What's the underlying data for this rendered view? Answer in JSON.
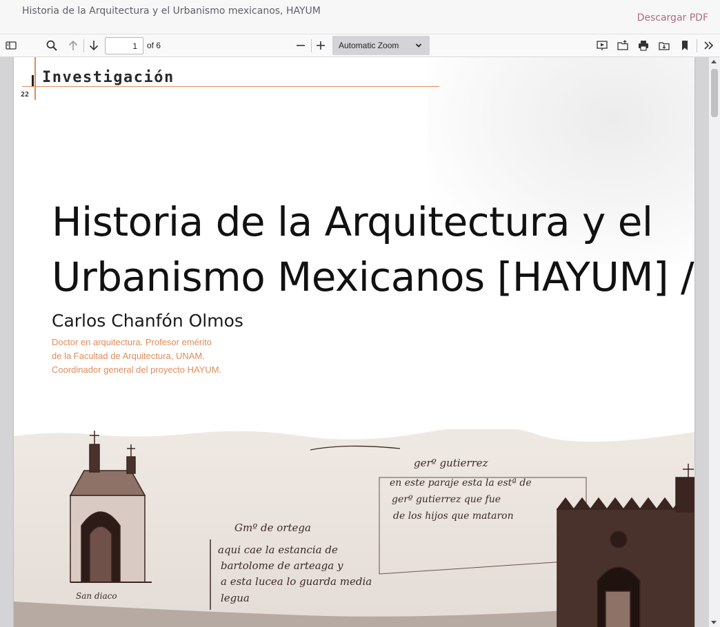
{
  "header": {
    "title": "Historia de la Arquitectura y el Urbanismo mexicanos, HAYUM",
    "download_label": "Descargar PDF"
  },
  "toolbar": {
    "current_page": "1",
    "page_count": "of 6",
    "zoom": "Automatic Zoom"
  },
  "page": {
    "section": "Investigación",
    "page_number": "22",
    "title_line1": "Historia de la Arquitectura y el",
    "title_line2": "Urbanismo Mexicanos [HAYUM] /",
    "author": "Carlos Chanfón Olmos",
    "affiliation": [
      "Doctor en arquitectura. Profesor emérito",
      "de la Facultad de Arquitectura, UNAM.",
      "Coordinador general del proyecto HAYUM."
    ]
  },
  "manuscript": {
    "labels": [
      "gerº gutierrez",
      "Gmº de ortega",
      "San diaco"
    ],
    "note_left": [
      "aqui cae la estancia de",
      "bartolome de arteaga y",
      "a esta lucea lo guarda media",
      "legua"
    ],
    "note_right": [
      "en este paraje esta la estª de",
      "gerº gutierrez que fue",
      "de los hijos que mataron"
    ]
  },
  "colors": {
    "accent_download": "#b06c80",
    "rule_orange": "#e08c5c",
    "toolbar_bg": "#f9f9fa",
    "viewer_bg": "#d4d4d7"
  }
}
